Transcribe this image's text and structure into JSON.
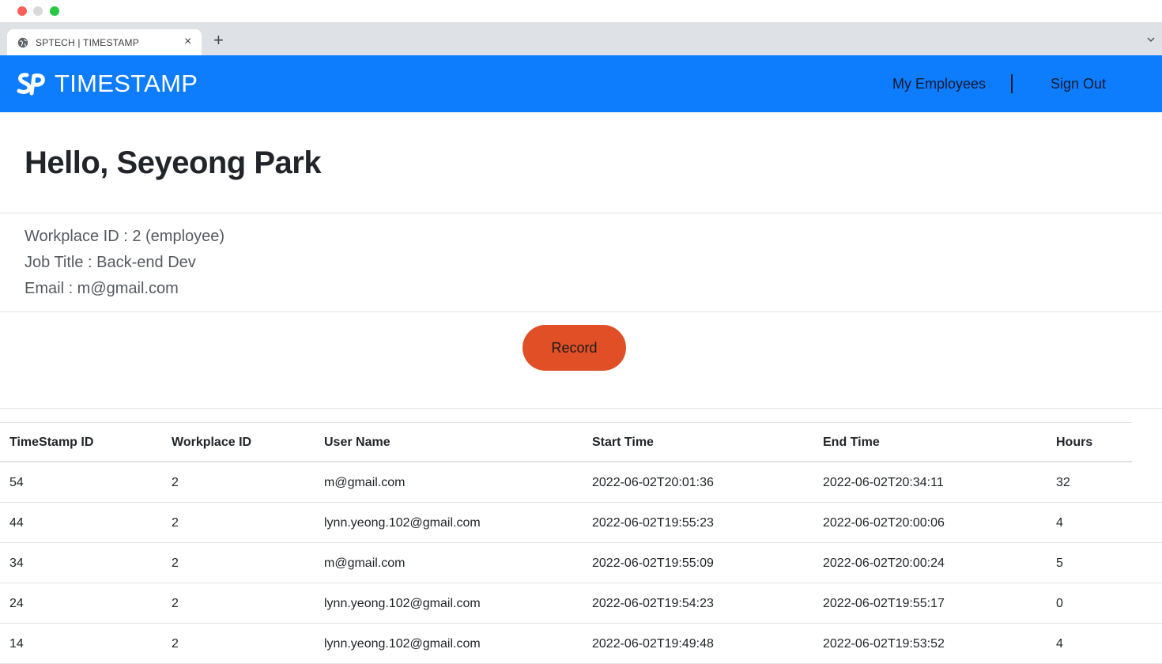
{
  "browser": {
    "tab_title": "SPTECH | TIMESTAMP",
    "tab_close": "×",
    "new_tab": "+"
  },
  "navbar": {
    "brand_text": "TIMESTAMP",
    "links": {
      "employees": "My Employees",
      "signout": "Sign Out"
    },
    "colors": {
      "background": "#0d7cfd",
      "link": "#111a2e"
    }
  },
  "profile": {
    "greeting": "Hello, Seyeong Park",
    "workplace": "Workplace ID : 2 (employee)",
    "job_title": "Job Title : Back-end Dev",
    "email": "Email : m@gmail.com"
  },
  "record_button": {
    "label": "Record",
    "color": "#e04f25"
  },
  "table": {
    "headers": [
      "TimeStamp ID",
      "Workplace ID",
      "User Name",
      "Start Time",
      "End Time",
      "Hours"
    ],
    "rows": [
      [
        "54",
        "2",
        "m@gmail.com",
        "2022-06-02T20:01:36",
        "2022-06-02T20:34:11",
        "32"
      ],
      [
        "44",
        "2",
        "lynn.yeong.102@gmail.com",
        "2022-06-02T19:55:23",
        "2022-06-02T20:00:06",
        "4"
      ],
      [
        "34",
        "2",
        "m@gmail.com",
        "2022-06-02T19:55:09",
        "2022-06-02T20:00:24",
        "5"
      ],
      [
        "24",
        "2",
        "lynn.yeong.102@gmail.com",
        "2022-06-02T19:54:23",
        "2022-06-02T19:55:17",
        "0"
      ],
      [
        "14",
        "2",
        "lynn.yeong.102@gmail.com",
        "2022-06-02T19:49:48",
        "2022-06-02T19:53:52",
        "4"
      ]
    ]
  }
}
